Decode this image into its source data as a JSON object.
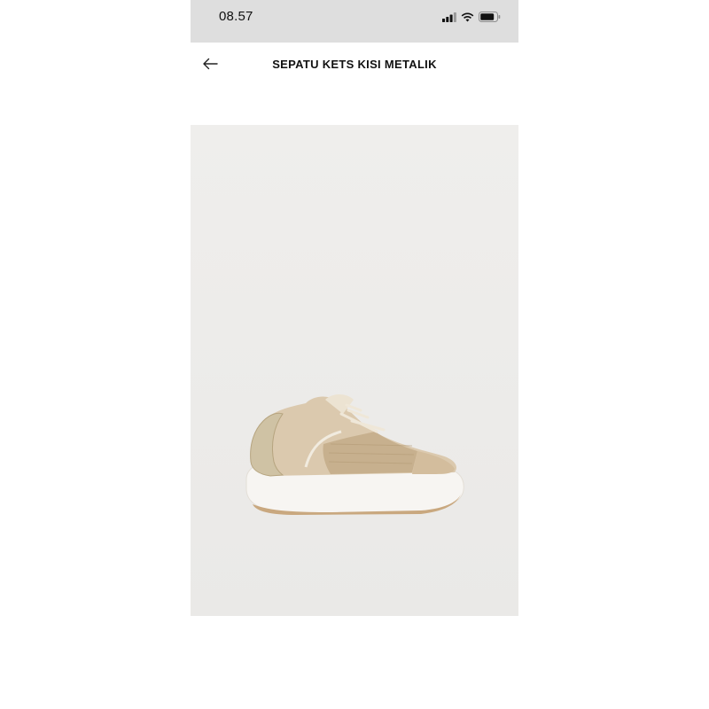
{
  "status_bar": {
    "time": "08.57",
    "icons": [
      "cellular-signal-icon",
      "wifi-icon",
      "battery-icon"
    ]
  },
  "header": {
    "back_icon": "arrow-left-icon",
    "title": "SEPATU KETS KISI METALIK"
  },
  "product": {
    "image_subject": "shoe-image"
  },
  "colors": {
    "status_bg": "#dedede",
    "image_bg": "#eceae8",
    "shoe_beige": "#d9c7ac",
    "sole_white": "#f7f5f2",
    "metallic_gold": "#cdbf9f"
  }
}
